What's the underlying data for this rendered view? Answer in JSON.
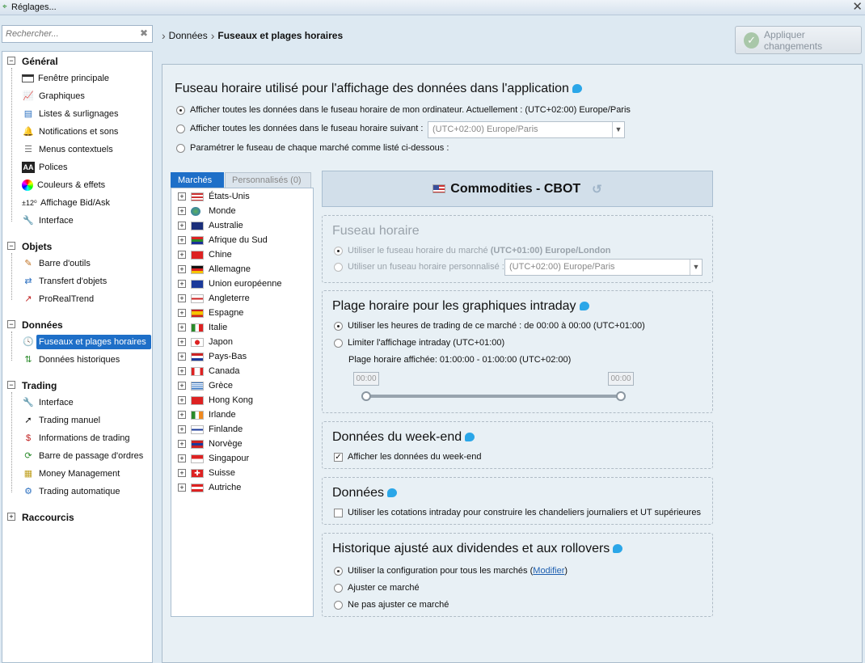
{
  "window": {
    "title": "Réglages..."
  },
  "search": {
    "placeholder": "Rechercher..."
  },
  "sidebar": {
    "categories": [
      {
        "label": "Général",
        "items": [
          "Fenêtre principale",
          "Graphiques",
          "Listes & surlignages",
          "Notifications et sons",
          "Menus contextuels",
          "Polices",
          "Couleurs & effets",
          "Affichage Bid/Ask",
          "Interface"
        ]
      },
      {
        "label": "Objets",
        "items": [
          "Barre d'outils",
          "Transfert d'objets",
          "ProRealTrend"
        ]
      },
      {
        "label": "Données",
        "items": [
          "Fuseaux et plages horaires",
          "Données historiques"
        ]
      },
      {
        "label": "Trading",
        "items": [
          "Interface",
          "Trading manuel",
          "Informations de trading",
          "Barre de passage d'ordres",
          "Money Management",
          "Trading automatique"
        ]
      },
      {
        "label": "Raccourcis",
        "items": []
      }
    ],
    "bidask_prefix": "±12⁰"
  },
  "breadcrumb": {
    "parent": "Données",
    "current": "Fuseaux et plages horaires"
  },
  "apply_button": {
    "label": "Appliquer changements"
  },
  "timezone_section": {
    "title": "Fuseau horaire utilisé pour l'affichage des données dans l'application",
    "opt1": "Afficher toutes les données dans le fuseau horaire de mon ordinateur. Actuellement : (UTC+02:00) Europe/Paris",
    "opt2": "Afficher toutes les données dans le fuseau horaire suivant :",
    "opt2_value": "(UTC+02:00) Europe/Paris",
    "opt3": "Paramétrer le fuseau de chaque marché comme listé ci-dessous :"
  },
  "tabs": {
    "markets": "Marchés",
    "custom": "Personnalisés (0)"
  },
  "markets": [
    "États-Unis",
    "Monde",
    "Australie",
    "Afrique du Sud",
    "Chine",
    "Allemagne",
    "Union européenne",
    "Angleterre",
    "Espagne",
    "Italie",
    "Japon",
    "Pays-Bas",
    "Canada",
    "Grèce",
    "Hong Kong",
    "Irlande",
    "Finlande",
    "Norvège",
    "Singapour",
    "Suisse",
    "Autriche"
  ],
  "market_header": {
    "title": "Commodities - CBOT"
  },
  "market_tz": {
    "title": "Fuseau horaire",
    "opt1_prefix": "Utiliser le fuseau horaire du marché",
    "opt1_bold": "(UTC+01:00) Europe/London",
    "opt2": "Utiliser un fuseau horaire personnalisé :",
    "opt2_value": "(UTC+02:00) Europe/Paris"
  },
  "intraday": {
    "title": "Plage horaire pour les graphiques intraday",
    "opt1": "Utiliser les heures de trading de ce marché : de 00:00 à 00:00 (UTC+01:00)",
    "opt2": "Limiter l'affichage intraday  (UTC+01:00)",
    "displayed": "Plage horaire affichée: 01:00:00 - 01:00:00 (UTC+02:00)",
    "start": "00:00",
    "end": "00:00"
  },
  "weekend": {
    "title": "Données du week-end",
    "checkbox": "Afficher les données du week-end",
    "checked": true
  },
  "data": {
    "title": "Données",
    "checkbox": "Utiliser les cotations intraday pour construire les chandeliers journaliers et UT supérieures",
    "checked": false
  },
  "history": {
    "title": "Historique ajusté aux dividendes et aux rollovers",
    "opt1": "Utiliser la configuration pour tous les marchés",
    "opt1_link": "Modifier",
    "opt2": "Ajuster ce marché",
    "opt3": "Ne pas ajuster ce marché"
  }
}
